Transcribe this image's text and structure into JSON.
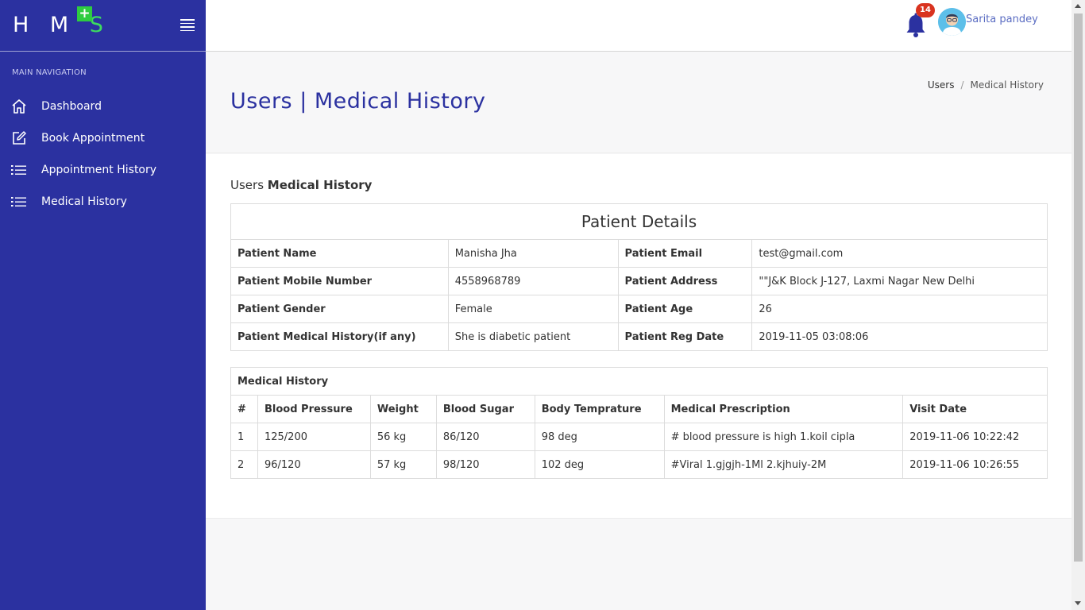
{
  "app": {
    "logo_letters": "H M",
    "logo_s": "S",
    "logo_plus": "+"
  },
  "sidebar": {
    "nav_title": "MAIN NAVIGATION",
    "items": [
      {
        "label": "Dashboard",
        "icon": "home-icon"
      },
      {
        "label": "Book Appointment",
        "icon": "edit-icon"
      },
      {
        "label": "Appointment History",
        "icon": "list-icon"
      },
      {
        "label": "Medical History",
        "icon": "list-icon"
      }
    ]
  },
  "header": {
    "notification_count": "14",
    "user_name": "Sarita pandey"
  },
  "page": {
    "title": "Users | Medical History",
    "breadcrumb": [
      "Users",
      "Medical History"
    ],
    "section_prefix": "Users",
    "section_bold": "Medical History"
  },
  "patient": {
    "caption": "Patient Details",
    "rows": [
      [
        {
          "k": "Patient Name",
          "v": "Manisha Jha"
        },
        {
          "k": "Patient Email",
          "v": "test@gmail.com"
        }
      ],
      [
        {
          "k": "Patient Mobile Number",
          "v": "4558968789"
        },
        {
          "k": "Patient Address",
          "v": "\"\"J&K Block J-127, Laxmi Nagar New Delhi"
        }
      ],
      [
        {
          "k": "Patient Gender",
          "v": "Female"
        },
        {
          "k": "Patient Age",
          "v": "26"
        }
      ],
      [
        {
          "k": "Patient Medical History(if any)",
          "v": "She is diabetic patient"
        },
        {
          "k": "Patient Reg Date",
          "v": "2019-11-05 03:08:06"
        }
      ]
    ]
  },
  "history": {
    "caption": "Medical History",
    "headers": [
      "#",
      "Blood Pressure",
      "Weight",
      "Blood Sugar",
      "Body Temprature",
      "Medical Prescription",
      "Visit Date"
    ],
    "rows": [
      [
        "1",
        "125/200",
        "56 kg",
        "86/120",
        "98 deg",
        "# blood pressure is high 1.koil cipla",
        "2019-11-06 10:22:42"
      ],
      [
        "2",
        "96/120",
        "57 kg",
        "98/120",
        "102 deg",
        "#Viral 1.gjgjh-1Ml 2.kjhuiy-2M",
        "2019-11-06 10:26:55"
      ]
    ]
  },
  "colors": {
    "sidebar_bg": "#2b31a0",
    "accent_green": "#2ecc40",
    "title_blue": "#2b31a0",
    "badge_red": "#d9331f"
  }
}
